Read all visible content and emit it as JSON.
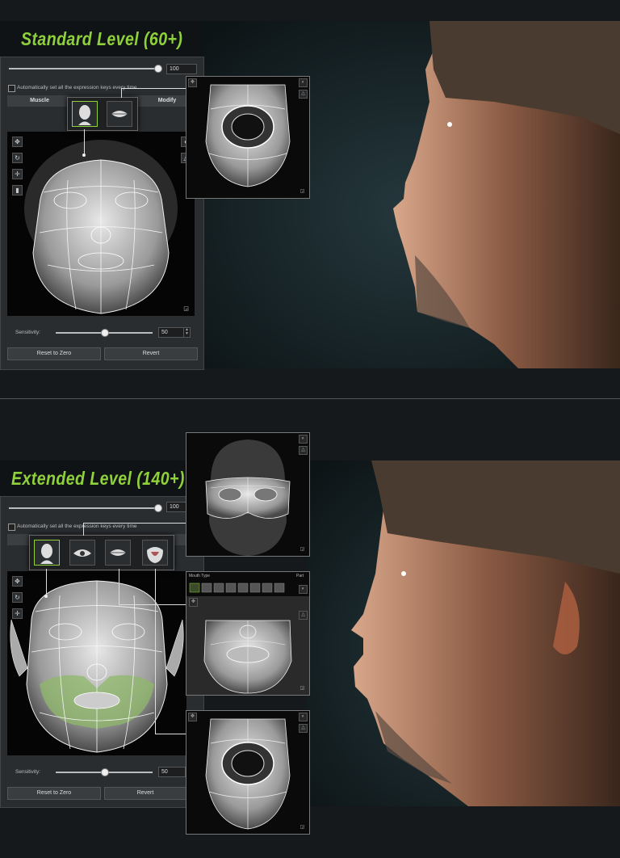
{
  "colors": {
    "accent": "#8fd13a",
    "panel": "#2a2d30",
    "viewport": "#050505"
  },
  "standard": {
    "title": "Standard Level (60+)",
    "strength_value": "100",
    "auto_keys_label": "Automatically set all the expression keys every time",
    "tabs": [
      "Muscle",
      "Modify"
    ],
    "sensitivity_label": "Sensitivity:",
    "sensitivity_value": "50",
    "sensitivity_fraction": 0.5,
    "reset_label": "Reset to Zero",
    "revert_label": "Revert"
  },
  "extended": {
    "title": "Extended Level (140+)",
    "strength_value": "100",
    "auto_keys_label": "Automatically set all the expression keys every time",
    "sensitivity_label": "Sensitivity:",
    "sensitivity_value": "50",
    "sensitivity_fraction": 0.5,
    "reset_label": "Reset to Zero",
    "revert_label": "Revert",
    "mouth_panel": {
      "mouth_type_label": "Mouth Type",
      "part_label": "Part"
    }
  }
}
